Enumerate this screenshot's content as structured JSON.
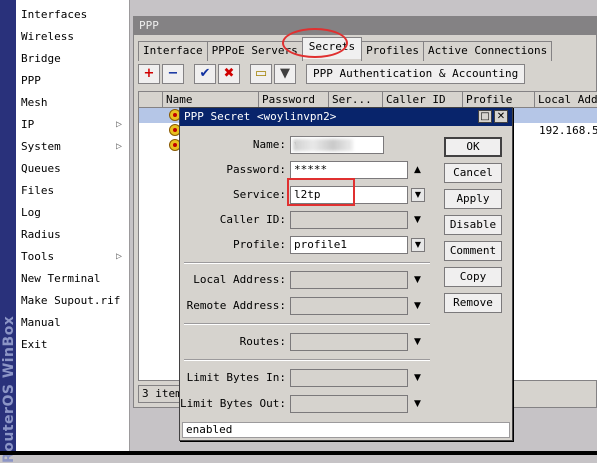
{
  "sidebar": {
    "brand": "RouterOS WinBox",
    "items": [
      {
        "label": "Interfaces",
        "submenu": false
      },
      {
        "label": "Wireless",
        "submenu": false
      },
      {
        "label": "Bridge",
        "submenu": false
      },
      {
        "label": "PPP",
        "submenu": false
      },
      {
        "label": "Mesh",
        "submenu": false
      },
      {
        "label": "IP",
        "submenu": true
      },
      {
        "label": "System",
        "submenu": true
      },
      {
        "label": "Queues",
        "submenu": false
      },
      {
        "label": "Files",
        "submenu": false
      },
      {
        "label": "Log",
        "submenu": false
      },
      {
        "label": "Radius",
        "submenu": false
      },
      {
        "label": "Tools",
        "submenu": true
      },
      {
        "label": "New Terminal",
        "submenu": false
      },
      {
        "label": "Make Supout.rif",
        "submenu": false
      },
      {
        "label": "Manual",
        "submenu": false
      },
      {
        "label": "Exit",
        "submenu": false
      }
    ],
    "submenu_glyph": "▷"
  },
  "ppp_window": {
    "title": "PPP",
    "tabs": [
      "Interface",
      "PPPoE Servers",
      "Secrets",
      "Profiles",
      "Active Connections"
    ],
    "active_tab": "Secrets",
    "toolbar": {
      "add": "+",
      "remove": "−",
      "enable": "✔",
      "disable": "✖",
      "comment": "▭",
      "filter": "▼",
      "auth_button": "PPP Authentication & Accounting"
    },
    "columns": [
      "Name",
      "Password",
      "Ser...",
      "Caller ID",
      "Profile",
      "Local Addre"
    ],
    "rows": [
      {
        "local_address": ""
      },
      {
        "local_address": "192.168.5.1"
      },
      {
        "local_address": ""
      }
    ],
    "status": "3 items"
  },
  "dialog": {
    "title": "PPP Secret <woylinvpn2>",
    "title_buttons": {
      "restore": "□",
      "close": "✕"
    },
    "fields": {
      "name": {
        "label": "Name:",
        "value": "v"
      },
      "password": {
        "label": "Password:",
        "value": "*****"
      },
      "service": {
        "label": "Service:",
        "value": "l2tp"
      },
      "caller_id": {
        "label": "Caller ID:",
        "value": ""
      },
      "profile": {
        "label": "Profile:",
        "value": "profile1"
      },
      "local_address": {
        "label": "Local Address:",
        "value": ""
      },
      "remote_address": {
        "label": "Remote Address:",
        "value": ""
      },
      "routes": {
        "label": "Routes:",
        "value": ""
      },
      "limit_in": {
        "label": "Limit Bytes In:",
        "value": ""
      },
      "limit_out": {
        "label": "Limit Bytes Out:",
        "value": ""
      }
    },
    "buttons": {
      "ok": "OK",
      "cancel": "Cancel",
      "apply": "Apply",
      "disable": "Disable",
      "comment": "Comment",
      "copy": "Copy",
      "remove": "Remove"
    },
    "status": "enabled"
  },
  "glyphs": {
    "dropdown": "▼",
    "up": "▲",
    "down": "▼"
  },
  "colors": {
    "annotation": "#e03030",
    "dialog_title_bar": "#08246b",
    "selected_row": "#b5c6e7",
    "brand_bar": "#29317b",
    "add_icon": "#d00000",
    "remove_icon": "#1030a0",
    "enable_icon": "#1030a0",
    "disable_icon": "#d00000",
    "comment_icon": "#f0d000"
  }
}
